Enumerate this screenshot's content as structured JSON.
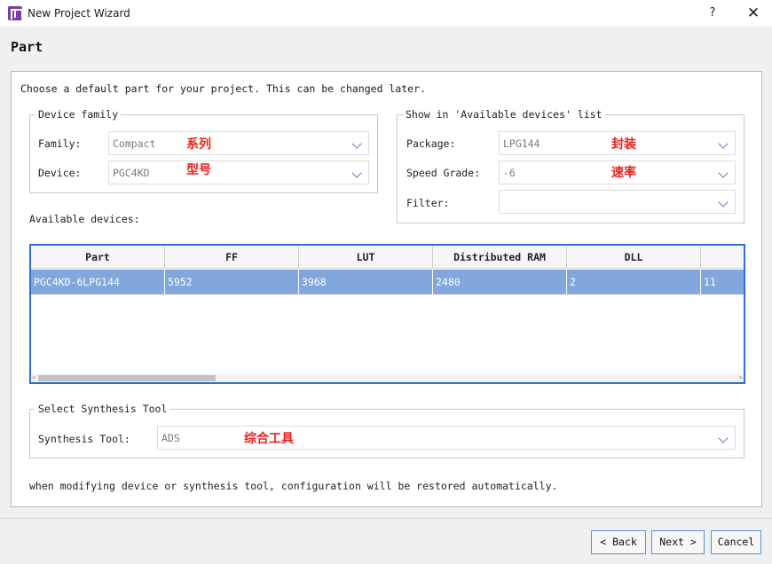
{
  "window": {
    "title": "New Project Wizard",
    "help": "?",
    "close": "✕"
  },
  "page": {
    "title": "Part",
    "intro": "Choose a default part for your project. This can be changed later."
  },
  "device_family": {
    "legend": "Device family",
    "family_label": "Family:",
    "family_value": "Compact",
    "family_note": "系列",
    "device_label": "Device:",
    "device_value": "PGC4KD",
    "device_note": "型号"
  },
  "show_in": {
    "legend": "Show in 'Available devices' list",
    "package_label": "Package:",
    "package_value": "LPG144",
    "package_note": "封装",
    "speed_label": "Speed Grade:",
    "speed_value": "-6",
    "speed_note": "速率",
    "filter_label": "Filter:",
    "filter_value": ""
  },
  "available": {
    "label": "Available devices:",
    "columns": [
      "Part",
      "FF",
      "LUT",
      "Distributed RAM",
      "DLL",
      ""
    ],
    "rows": [
      [
        "PGC4KD-6LPG144",
        "5952",
        "3968",
        "2480",
        "2",
        "11"
      ]
    ],
    "scroll_left": "<",
    "scroll_right": ">"
  },
  "synthesis": {
    "legend": "Select Synthesis Tool",
    "tool_label": "Synthesis Tool:",
    "tool_value": "ADS",
    "tool_note": "综合工具"
  },
  "footer_note": "when modifying device or synthesis tool, configuration will be restored automatically.",
  "buttons": {
    "back": "< Back",
    "next": "Next >",
    "cancel": "Cancel"
  },
  "colors": {
    "selection": "#82a7dc",
    "accent": "#2f6fd1",
    "note": "#e8231e"
  }
}
